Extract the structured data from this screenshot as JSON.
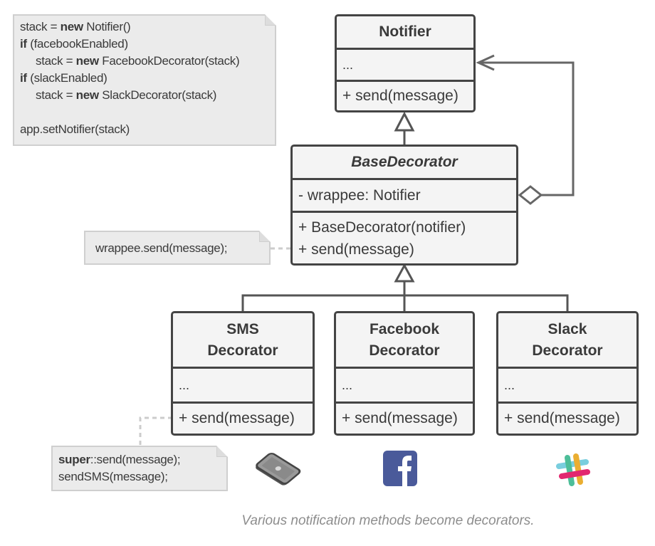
{
  "notes": {
    "client_code": {
      "lines": [
        {
          "indent": false,
          "parts": [
            {
              "text": "stack = ",
              "bold": false
            },
            {
              "text": "new",
              "bold": true
            },
            {
              "text": " Notifier()",
              "bold": false
            }
          ]
        },
        {
          "indent": false,
          "parts": [
            {
              "text": "if",
              "bold": true
            },
            {
              "text": " (facebookEnabled)",
              "bold": false
            }
          ]
        },
        {
          "indent": true,
          "parts": [
            {
              "text": "stack = ",
              "bold": false
            },
            {
              "text": "new",
              "bold": true
            },
            {
              "text": " FacebookDecorator(stack)",
              "bold": false
            }
          ]
        },
        {
          "indent": false,
          "parts": [
            {
              "text": "if",
              "bold": true
            },
            {
              "text": " (slackEnabled)",
              "bold": false
            }
          ]
        },
        {
          "indent": true,
          "parts": [
            {
              "text": "stack = ",
              "bold": false
            },
            {
              "text": "new",
              "bold": true
            },
            {
              "text": " SlackDecorator(stack)",
              "bold": false
            }
          ]
        },
        {
          "indent": false,
          "parts": [
            {
              "text": "",
              "bold": false
            }
          ]
        },
        {
          "indent": false,
          "parts": [
            {
              "text": "app.setNotifier(stack)",
              "bold": false
            }
          ]
        }
      ]
    },
    "base_send": {
      "text": "wrappee.send(message);"
    },
    "sms_send": {
      "line1_bold": "super",
      "line1_rest": "::send(message);",
      "line2": "sendSMS(message);"
    }
  },
  "classes": {
    "notifier": {
      "name": "Notifier",
      "fields": "...",
      "methods": [
        "+ send(message)"
      ]
    },
    "base_decorator": {
      "name": "BaseDecorator",
      "abstract": true,
      "fields": "- wrappee: Notifier",
      "methods": [
        "+ BaseDecorator(notifier)",
        "+ send(message)"
      ]
    },
    "sms_decorator": {
      "name_line1": "SMS",
      "name_line2": "Decorator",
      "fields": "...",
      "methods": [
        "+ send(message)"
      ]
    },
    "facebook_decorator": {
      "name_line1": "Facebook",
      "name_line2": "Decorator",
      "fields": "...",
      "methods": [
        "+ send(message)"
      ]
    },
    "slack_decorator": {
      "name_line1": "Slack",
      "name_line2": "Decorator",
      "fields": "...",
      "methods": [
        "+ send(message)"
      ]
    }
  },
  "relations": [
    {
      "type": "inheritance",
      "from": "BaseDecorator",
      "to": "Notifier"
    },
    {
      "type": "aggregation",
      "from": "BaseDecorator",
      "to": "Notifier",
      "label": "wrappee"
    },
    {
      "type": "inheritance",
      "from": "SMS Decorator",
      "to": "BaseDecorator"
    },
    {
      "type": "inheritance",
      "from": "Facebook Decorator",
      "to": "BaseDecorator"
    },
    {
      "type": "inheritance",
      "from": "Slack Decorator",
      "to": "BaseDecorator"
    }
  ],
  "icons": {
    "sms": "phone-icon",
    "facebook": "facebook-icon",
    "slack": "slack-icon"
  },
  "colors": {
    "facebook": "#4a5a9a",
    "slack_teal": "#3eb991",
    "slack_blue": "#6ecadc",
    "slack_yellow": "#e9a820",
    "slack_red": "#e01563",
    "line": "#666666",
    "border": "#444444"
  },
  "caption": "Various notification methods become decorators."
}
